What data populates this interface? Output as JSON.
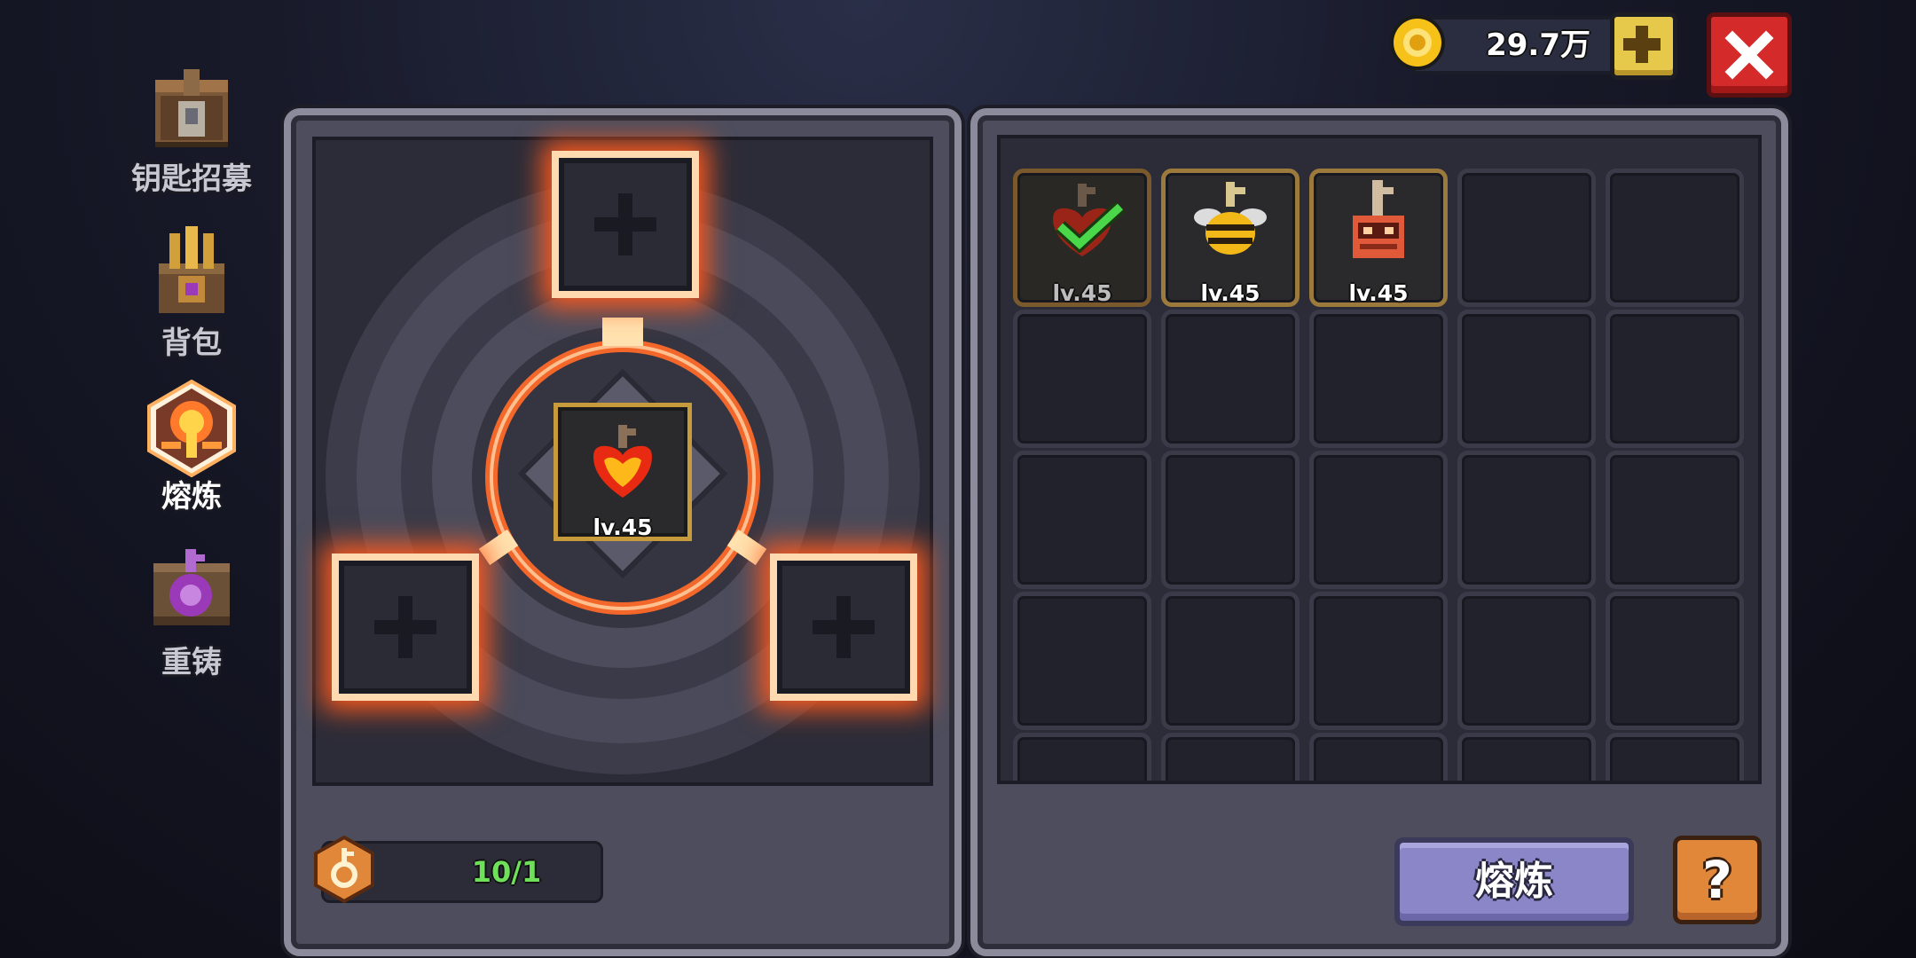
{
  "header": {
    "coin_amount": "29.7万",
    "add_icon": "plus-icon",
    "close_icon": "close-icon"
  },
  "nav": {
    "items": [
      {
        "label": "钥匙招募",
        "icon": "key-chest-icon",
        "active": false
      },
      {
        "label": "背包",
        "icon": "backpack-icon",
        "active": false
      },
      {
        "label": "熔炼",
        "icon": "smelt-furnace-icon",
        "active": true
      },
      {
        "label": "重铸",
        "icon": "recast-key-icon",
        "active": false
      }
    ]
  },
  "forge": {
    "center_item": {
      "level": "lv.45",
      "icon": "red-fire-key-icon"
    },
    "slots": [
      "empty",
      "empty",
      "empty"
    ],
    "key_count": "10/1",
    "key_icon": "orange-key-badge-icon"
  },
  "inventory": {
    "items": [
      {
        "level": "lv.45",
        "icon": "red-fire-key-icon",
        "selected": true
      },
      {
        "level": "lv.45",
        "icon": "bee-key-icon",
        "selected": false
      },
      {
        "level": "lv.45",
        "icon": "robot-key-icon",
        "selected": false
      }
    ]
  },
  "actions": {
    "smelt_label": "熔炼",
    "help_label": "?"
  },
  "colors": {
    "accent_glow": "#ff5a1e",
    "coin": "#f6c21a",
    "forge_button": "#8a86c8",
    "close_button": "#d42a2a",
    "help_button": "#e0873a",
    "count_text": "#6ee05a"
  }
}
